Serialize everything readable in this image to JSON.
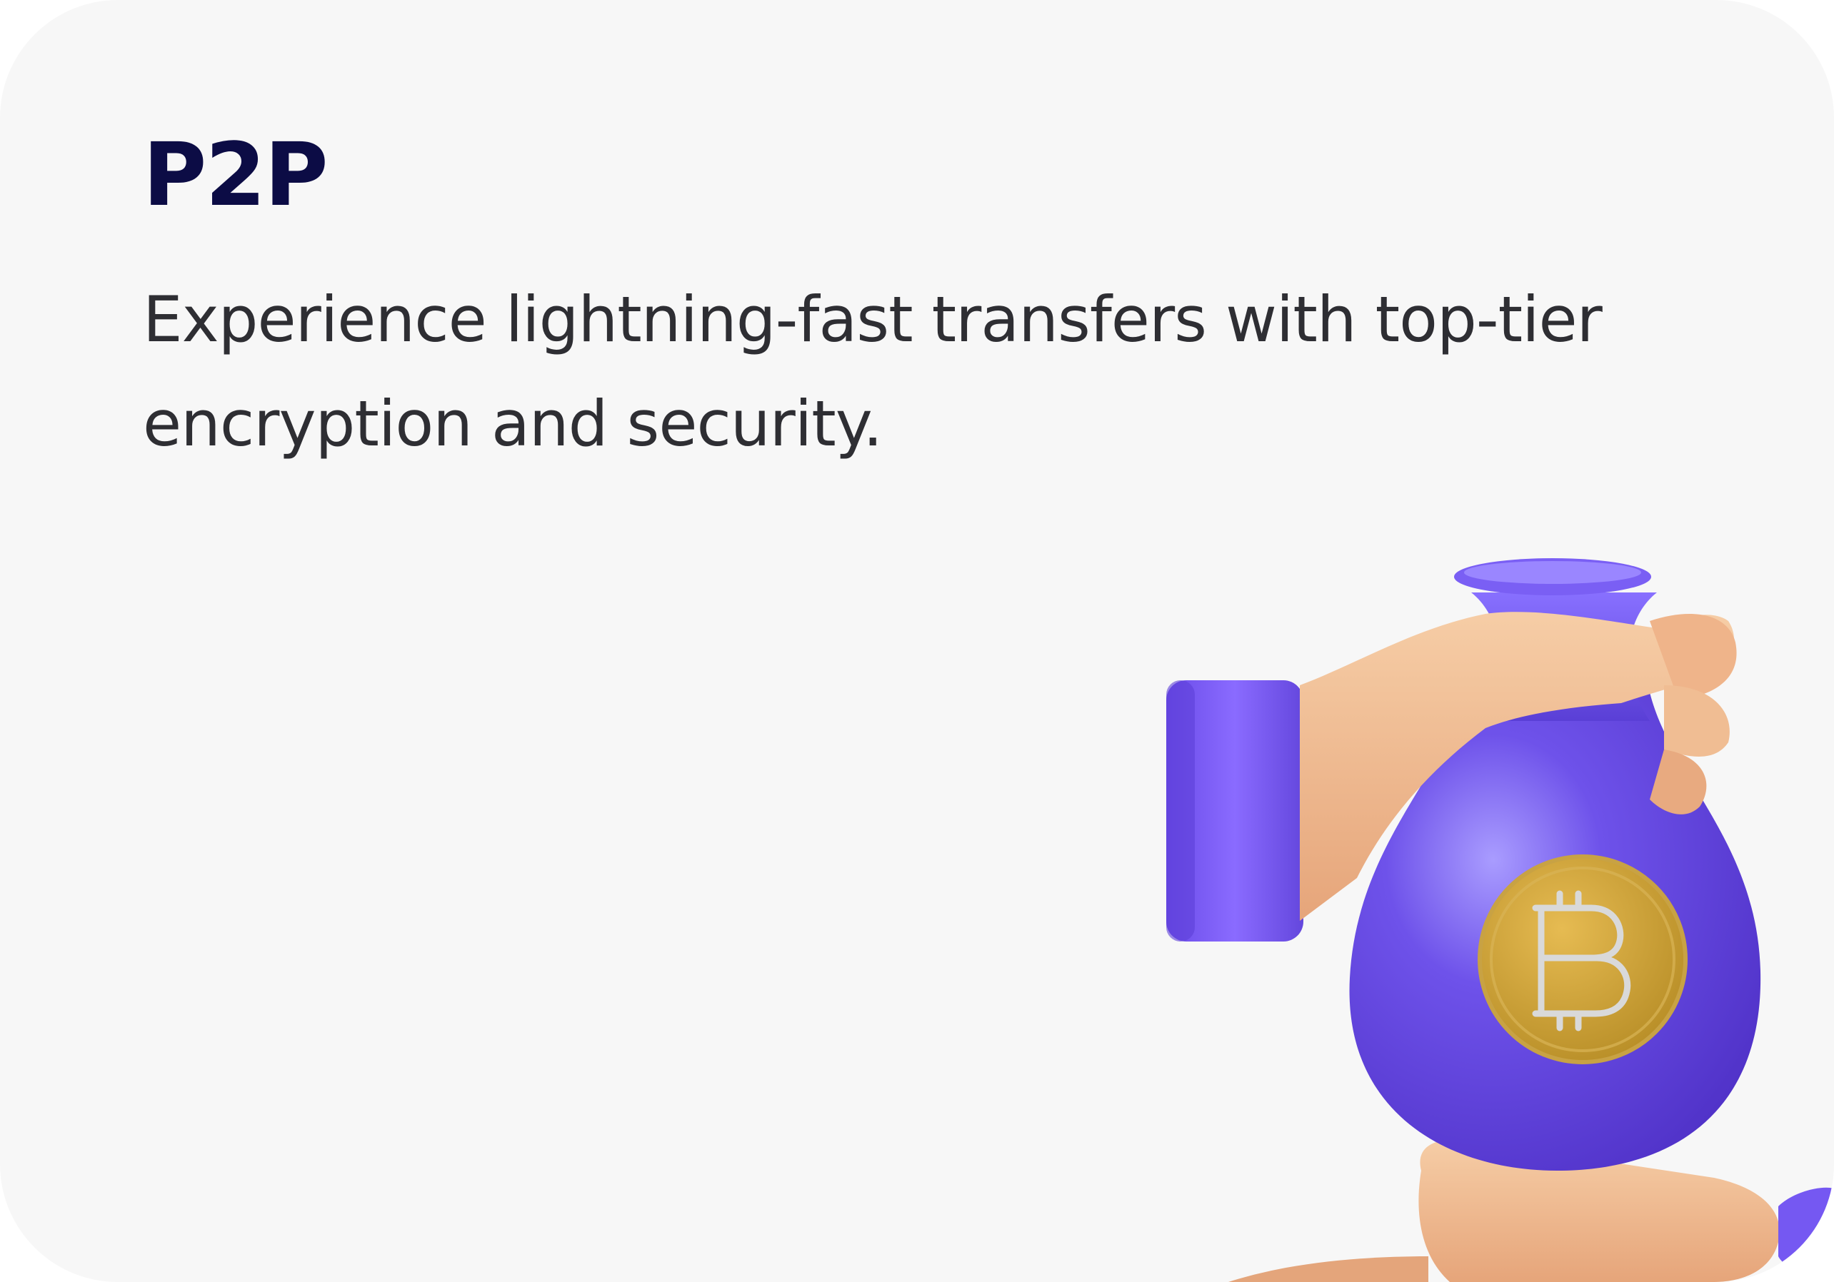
{
  "card": {
    "title": "P2P",
    "description": "Experience lightning-fast transfers with top-tier encryption and security."
  },
  "illustration": {
    "icon": "bitcoin-money-bag-in-hand",
    "coin_icon": "bitcoin-icon",
    "colors": {
      "bag": "#6b4fe8",
      "cuff": "#7b5cf5",
      "skin": "#f2b98c",
      "coin": "#d4a23a"
    }
  }
}
